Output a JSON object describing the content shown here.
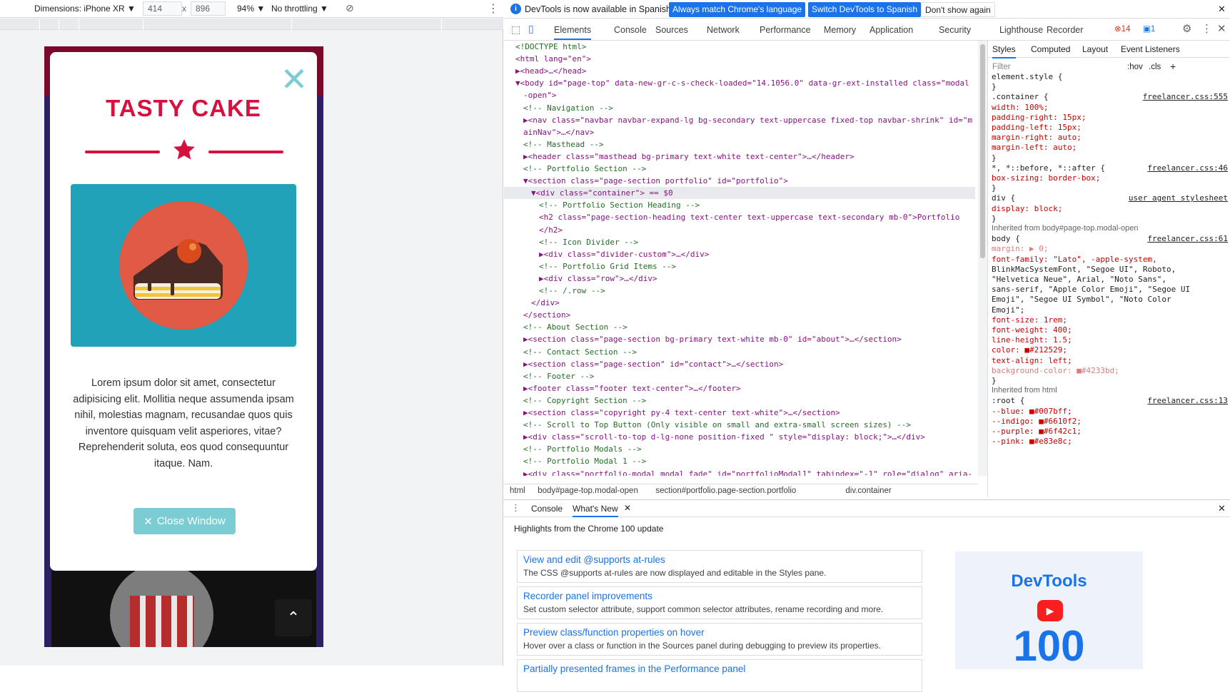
{
  "device_toolbar": {
    "dimensions_label": "Dimensions: iPhone XR ▼",
    "width": "414",
    "times": "x",
    "height": "896",
    "zoom": "94% ▼",
    "throttling": "No throttling ▼"
  },
  "modal": {
    "title": "TASTY CAKE",
    "description": "Lorem ipsum dolor sit amet, consectetur adipisicing elit. Mollitia neque assumenda ipsam nihil, molestias magnam, recusandae quos quis inventore quisquam velit asperiores, vitae? Reprehenderit soluta, eos quod consequuntur itaque. Nam.",
    "close_button": "Close Window"
  },
  "infobar": {
    "message": "DevTools is now available in Spanish!",
    "btn_match": "Always match Chrome's language",
    "btn_switch": "Switch DevTools to Spanish",
    "btn_dismiss": "Don't show again"
  },
  "tabs": [
    "Elements",
    "Console",
    "Sources",
    "Network",
    "Performance",
    "Memory",
    "Application",
    "Security",
    "Lighthouse",
    "Recorder"
  ],
  "badges": {
    "errors": "14",
    "messages": "1"
  },
  "elements_lines": [
    {
      "i": 1,
      "t": "<!DOCTYPE html>",
      "c": "com"
    },
    {
      "i": 1,
      "t": "<html lang=\"en\">",
      "c": "tag"
    },
    {
      "i": 1,
      "t": "▶<head>…</head>",
      "c": "tag"
    },
    {
      "i": 1,
      "t": "▼<body id=\"page-top\" data-new-gr-c-s-check-loaded=\"14.1056.0\" data-gr-ext-installed class=\"modal",
      "c": "tag"
    },
    {
      "i": 2,
      "t": "-open\">",
      "c": "tag"
    },
    {
      "i": 2,
      "t": "<!-- Navigation -->",
      "c": "com"
    },
    {
      "i": 2,
      "t": "▶<nav class=\"navbar navbar-expand-lg bg-secondary text-uppercase fixed-top navbar-shrink\" id=\"m",
      "c": "tag"
    },
    {
      "i": 2,
      "t": "ainNav\">…</nav>",
      "c": "tag"
    },
    {
      "i": 2,
      "t": "<!-- Masthead -->",
      "c": "com"
    },
    {
      "i": 2,
      "t": "▶<header class=\"masthead bg-primary text-white text-center\">…</header>",
      "c": "tag"
    },
    {
      "i": 2,
      "t": "<!-- Portfolio Section -->",
      "c": "com"
    },
    {
      "i": 2,
      "t": "▼<section class=\"page-section portfolio\" id=\"portfolio\">",
      "c": "tag"
    },
    {
      "i": 3,
      "t": "▼<div class=\"container\"> == $0",
      "c": "tag"
    },
    {
      "i": 4,
      "t": "<!-- Portfolio Section Heading -->",
      "c": "com"
    },
    {
      "i": 4,
      "t": "<h2 class=\"page-section-heading text-center text-uppercase text-secondary mb-0\">Portfolio",
      "c": "tag"
    },
    {
      "i": 4,
      "t": "</h2>",
      "c": "tag"
    },
    {
      "i": 4,
      "t": "<!-- Icon Divider -->",
      "c": "com"
    },
    {
      "i": 4,
      "t": "▶<div class=\"divider-custom\">…</div>",
      "c": "tag"
    },
    {
      "i": 4,
      "t": "<!-- Portfolio Grid Items -->",
      "c": "com"
    },
    {
      "i": 4,
      "t": "▶<div class=\"row\">…</div>",
      "c": "tag"
    },
    {
      "i": 4,
      "t": "<!-- /.row -->",
      "c": "com"
    },
    {
      "i": 3,
      "t": "</div>",
      "c": "tag"
    },
    {
      "i": 2,
      "t": "</section>",
      "c": "tag"
    },
    {
      "i": 2,
      "t": "<!-- About Section -->",
      "c": "com"
    },
    {
      "i": 2,
      "t": "▶<section class=\"page-section bg-primary text-white mb-0\" id=\"about\">…</section>",
      "c": "tag"
    },
    {
      "i": 2,
      "t": "<!-- Contact Section -->",
      "c": "com"
    },
    {
      "i": 2,
      "t": "▶<section class=\"page-section\" id=\"contact\">…</section>",
      "c": "tag"
    },
    {
      "i": 2,
      "t": "<!-- Footer -->",
      "c": "com"
    },
    {
      "i": 2,
      "t": "▶<footer class=\"footer text-center\">…</footer>",
      "c": "tag"
    },
    {
      "i": 2,
      "t": "<!-- Copyright Section -->",
      "c": "com"
    },
    {
      "i": 2,
      "t": "▶<section class=\"copyright py-4 text-center text-white\">…</section>",
      "c": "tag"
    },
    {
      "i": 2,
      "t": "<!-- Scroll to Top Button (Only visible on small and extra-small screen sizes) -->",
      "c": "com"
    },
    {
      "i": 2,
      "t": "▶<div class=\"scroll-to-top d-lg-none position-fixed \" style=\"display: block;\">…</div>",
      "c": "tag"
    },
    {
      "i": 2,
      "t": "<!-- Portfolio Modals -->",
      "c": "com"
    },
    {
      "i": 2,
      "t": "<!-- Portfolio Modal 1 -->",
      "c": "com"
    },
    {
      "i": 2,
      "t": "▶<div class=\"portfolio-modal modal fade\" id=\"portfolioModal1\" tabindex=\"-1\" role=\"dialog\" aria-",
      "c": "tag"
    }
  ],
  "breadcrumbs": [
    "html",
    "body#page-top.modal-open",
    "section#portfolio.page-section.portfolio",
    "div.container"
  ],
  "styles_tabs": [
    "Styles",
    "Computed",
    "Layout",
    "Event Listeners"
  ],
  "styles_filter_placeholder": "Filter",
  "styles_hov": ":hov",
  "styles_cls": ".cls",
  "styles_lines": [
    {
      "t": "element.style {",
      "k": "sel"
    },
    {
      "t": "}",
      "k": "sel"
    },
    {
      "t": ".container {",
      "k": "sel",
      "src": "freelancer.css:555"
    },
    {
      "t": "  width: 100%;",
      "k": "prop"
    },
    {
      "t": "  padding-right: 15px;",
      "k": "prop"
    },
    {
      "t": "  padding-left: 15px;",
      "k": "prop"
    },
    {
      "t": "  margin-right: auto;",
      "k": "prop"
    },
    {
      "t": "  margin-left: auto;",
      "k": "prop"
    },
    {
      "t": "}",
      "k": "sel"
    },
    {
      "t": "*, *::before, *::after {",
      "k": "sel",
      "src": "freelancer.css:46"
    },
    {
      "t": "  box-sizing: border-box;",
      "k": "prop"
    },
    {
      "t": "}",
      "k": "sel"
    },
    {
      "t": "div {",
      "k": "sel",
      "src": "user agent stylesheet"
    },
    {
      "t": "  display: block;",
      "k": "prop"
    },
    {
      "t": "}",
      "k": "sel"
    },
    {
      "t": "Inherited from body#page-top.modal-open",
      "k": "inh"
    },
    {
      "t": "body {",
      "k": "sel",
      "src": "freelancer.css:61"
    },
    {
      "t": "  margin: ▶ 0;",
      "k": "dim"
    },
    {
      "t": "  font-family: \"Lato\", -apple-system,",
      "k": "prop"
    },
    {
      "t": "     BlinkMacSystemFont, \"Segoe UI\", Roboto,",
      "k": "pv"
    },
    {
      "t": "     \"Helvetica Neue\", Arial, \"Noto Sans\",",
      "k": "pv"
    },
    {
      "t": "     sans-serif, \"Apple Color Emoji\", \"Segoe UI",
      "k": "pv"
    },
    {
      "t": "     Emoji\", \"Segoe UI Symbol\", \"Noto Color",
      "k": "pv"
    },
    {
      "t": "     Emoji\";",
      "k": "pv"
    },
    {
      "t": "  font-size: 1rem;",
      "k": "prop"
    },
    {
      "t": "  font-weight: 400;",
      "k": "prop"
    },
    {
      "t": "  line-height: 1.5;",
      "k": "prop"
    },
    {
      "t": "  color: ■#212529;",
      "k": "prop"
    },
    {
      "t": "  text-align: left;",
      "k": "prop"
    },
    {
      "t": "  background-color: ■#4233bd;",
      "k": "dim"
    },
    {
      "t": "}",
      "k": "sel"
    },
    {
      "t": "Inherited from html",
      "k": "inh"
    },
    {
      "t": ":root {",
      "k": "sel",
      "src": "freelancer.css:13"
    },
    {
      "t": "  --blue: ■#007bff;",
      "k": "prop"
    },
    {
      "t": "  --indigo: ■#6610f2;",
      "k": "prop"
    },
    {
      "t": "  --purple: ■#6f42c1;",
      "k": "prop"
    },
    {
      "t": "  --pink: ■#e83e8c;",
      "k": "prop"
    }
  ],
  "drawer": {
    "tabs": [
      "Console",
      "What's New"
    ],
    "highlights": "Highlights from the Chrome 100 update",
    "cards": [
      {
        "title": "View and edit @supports at-rules",
        "desc": "The CSS @supports at-rules are now displayed and editable in the Styles pane."
      },
      {
        "title": "Recorder panel improvements",
        "desc": "Set custom selector attribute, support common selector attributes, rename recording and more."
      },
      {
        "title": "Preview class/function properties on hover",
        "desc": "Hover over a class or function in the Sources panel during debugging to preview its properties."
      },
      {
        "title": "Partially presented frames in the Performance panel",
        "desc": ""
      }
    ],
    "promo_title": "DevTools",
    "promo_number": "100"
  },
  "colors": {
    "accent": "#1a73e8",
    "modal_title": "#d4113f",
    "teal": "#21a2b8",
    "button": "#7ccdd3"
  }
}
